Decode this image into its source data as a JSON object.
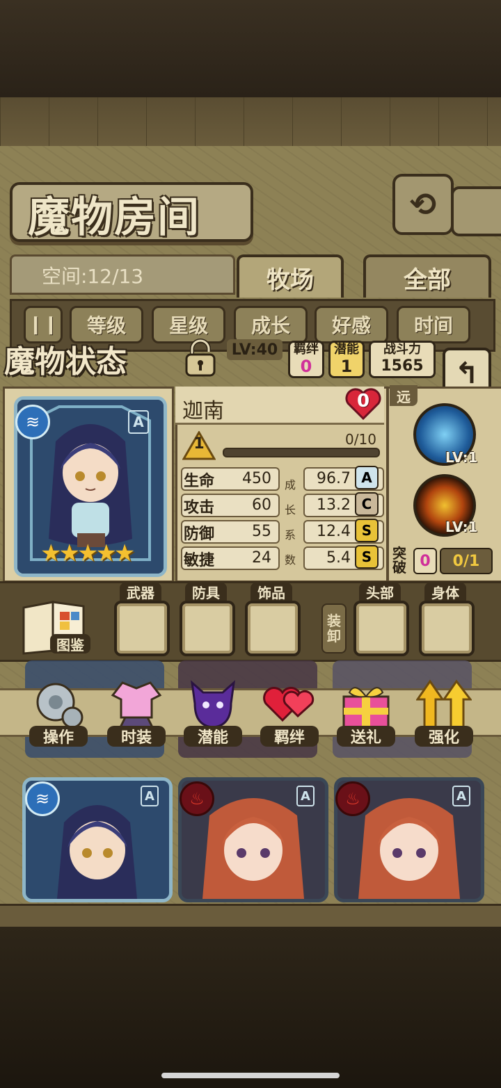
{
  "header": {
    "title": "魔物房间",
    "back_icon": "return-icon"
  },
  "room": {
    "space_text": "空间:12/13",
    "tabs": [
      {
        "label": "牧场",
        "active": true
      },
      {
        "label": "全部",
        "active": false
      }
    ],
    "sort_buttons": [
      "等级",
      "星级",
      "成长",
      "好感",
      "时间"
    ]
  },
  "status": {
    "label": "魔物状态",
    "level_tag": "LV:40",
    "bond_label": "羁绊",
    "bond_value": "0",
    "potential_label": "潜能",
    "potential_value": "1",
    "power_label": "战斗力",
    "power_value": "1565"
  },
  "monster": {
    "name": "迦南",
    "affection": "0",
    "rank": "1",
    "exp": "0/10",
    "exp_fraction": 0,
    "rarity": "A",
    "element": "water",
    "stars": 5
  },
  "stats": [
    {
      "label": "生命",
      "value": "450",
      "growth": "96.7",
      "grade": "A"
    },
    {
      "label": "攻击",
      "value": "60",
      "growth": "13.2",
      "grade": "C"
    },
    {
      "label": "防御",
      "value": "55",
      "growth": "12.4",
      "grade": "S"
    },
    {
      "label": "敏捷",
      "value": "24",
      "growth": "5.4",
      "grade": "S"
    }
  ],
  "growth_label": [
    "成",
    "长",
    "系",
    "数"
  ],
  "skills": {
    "range": "远",
    "items": [
      {
        "level": "LV:1",
        "icon": "lightning-skill-icon"
      },
      {
        "level": "LV:1",
        "icon": "sword-fire-skill-icon"
      }
    ],
    "break_label": "突破",
    "break_value": "0",
    "break_progress": "0/1"
  },
  "equipment": {
    "book_label": "图鉴",
    "slots_left": [
      "武器",
      "防具",
      "饰品"
    ],
    "unequip_label": "装卸",
    "slots_right": [
      "头部",
      "身体"
    ]
  },
  "actions": [
    {
      "label": "操作",
      "icon": "gear-icon"
    },
    {
      "label": "时装",
      "icon": "costume-icon"
    },
    {
      "label": "潜能",
      "icon": "demon-icon"
    },
    {
      "label": "羁绊",
      "icon": "hearts-icon"
    },
    {
      "label": "送礼",
      "icon": "gift-icon"
    },
    {
      "label": "强化",
      "icon": "upgrade-arrows-icon"
    }
  ],
  "monster_list": [
    {
      "element": "water",
      "rarity": "A"
    },
    {
      "element": "fire",
      "rarity": "A"
    },
    {
      "element": "fire",
      "rarity": "A"
    }
  ],
  "colors": {
    "panel": "#8d8155",
    "dark_border": "#3a2e1c",
    "bond_pink": "#d0309a",
    "potential_gold": "#8a6a10",
    "grade_gold": "#e8c238"
  }
}
